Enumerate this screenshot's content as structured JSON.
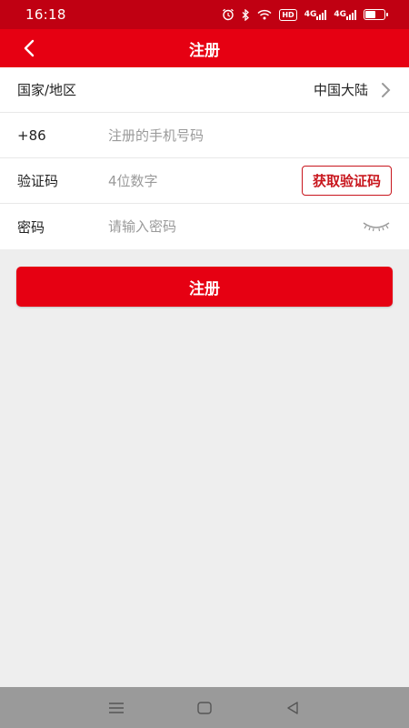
{
  "status_bar": {
    "time": "16:18",
    "hd": "HD",
    "signal1": "4G",
    "signal2": "4G",
    "battery_level": 0.6,
    "icons": [
      "alarm-icon",
      "bluetooth-icon",
      "wifi-icon",
      "hd-icon",
      "signal-icon",
      "signal-icon",
      "battery-icon"
    ]
  },
  "header": {
    "title": "注册",
    "back_icon": "chevron-left-icon"
  },
  "form": {
    "region": {
      "label": "国家/地区",
      "value": "中国大陆",
      "icon": "chevron-right-icon"
    },
    "phone": {
      "label": "+86",
      "placeholder": "注册的手机号码",
      "value": ""
    },
    "code": {
      "label": "验证码",
      "placeholder": "4位数字",
      "value": "",
      "button": "获取验证码"
    },
    "password": {
      "label": "密码",
      "placeholder": "请输入密码",
      "value": "",
      "icon": "eye-closed-icon"
    }
  },
  "submit_label": "注册",
  "nav_bar": {
    "icons": [
      "menu-icon",
      "home-icon",
      "back-triangle-icon"
    ]
  },
  "colors": {
    "primary": "#e60012",
    "status_bar": "#c00012",
    "background": "#eeeeee",
    "nav_bar": "#9a9a9a"
  }
}
